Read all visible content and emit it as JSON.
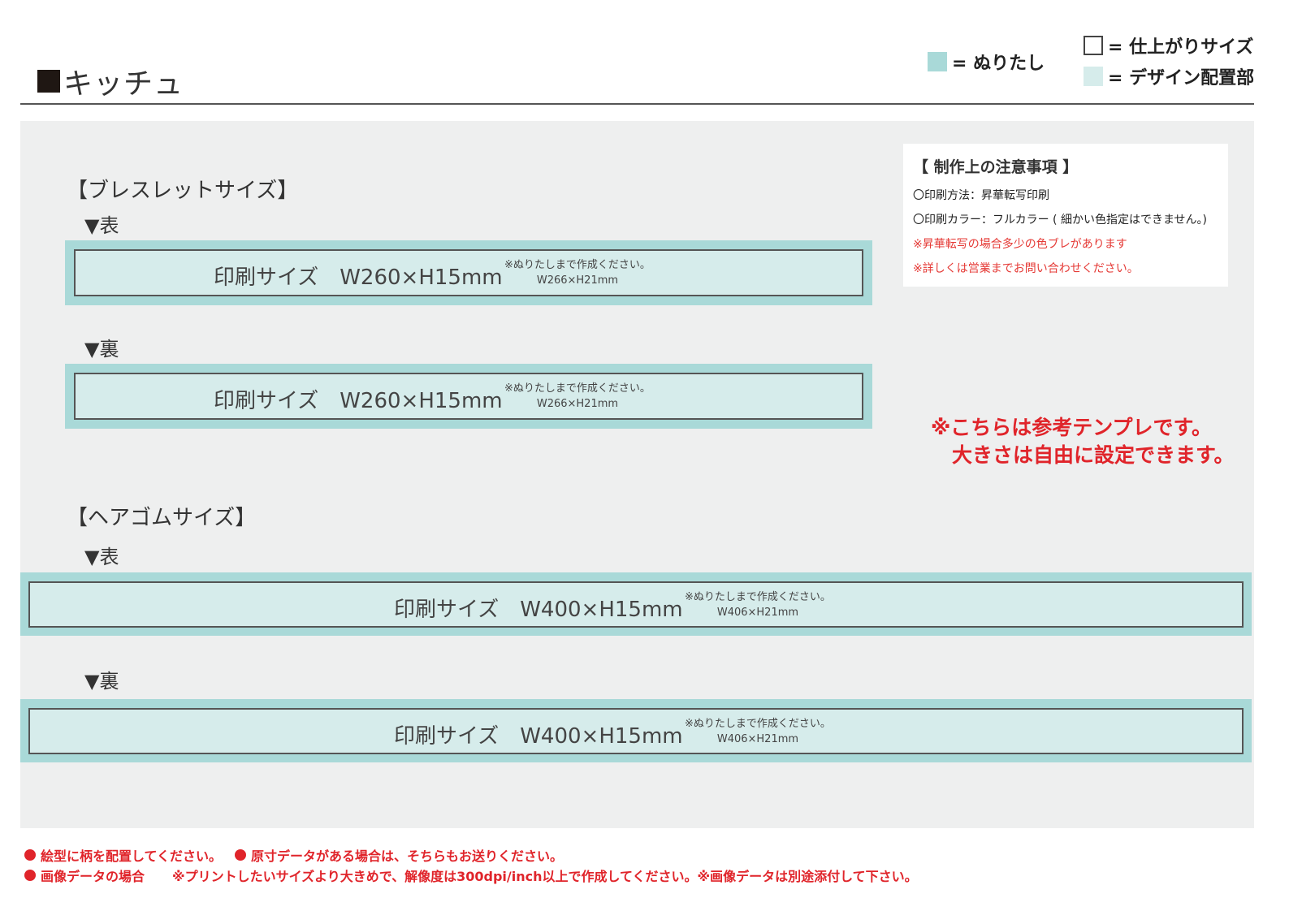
{
  "header": {
    "title": "キッチュ",
    "legend": {
      "bleed": "= ぬりたし",
      "finish": "= 仕上がりサイズ",
      "design": "= デザイン配置部"
    }
  },
  "bracelet": {
    "title": "【ブレスレットサイズ】",
    "front": {
      "label": "▼表",
      "size": "印刷サイズ　W260×H15mm",
      "note1": "※ぬりたしまで作成ください。",
      "note2": "W266×H21mm"
    },
    "back": {
      "label": "▼裏",
      "size": "印刷サイズ　W260×H15mm",
      "note1": "※ぬりたしまで作成ください。",
      "note2": "W266×H21mm"
    }
  },
  "hairtie": {
    "title": "【ヘアゴムサイズ】",
    "front": {
      "label": "▼表",
      "size": "印刷サイズ　W400×H15mm",
      "note1": "※ぬりたしまで作成ください。",
      "note2": "W406×H21mm"
    },
    "back": {
      "label": "▼裏",
      "size": "印刷サイズ　W400×H15mm",
      "note1": "※ぬりたしまで作成ください。",
      "note2": "W406×H21mm"
    }
  },
  "notes": {
    "heading": "【 制作上の注意事項 】",
    "lines": [
      "〇印刷方法：昇華転写印刷",
      "〇印刷カラー：フルカラー ( 細かい色指定はできません。)",
      "※昇華転写の場合多少の色ブレがあります",
      "※詳しくは営業までお問い合わせください。"
    ]
  },
  "reference_note": {
    "line1": "※こちらは参考テンプレです。",
    "line2": "大きさは自由に設定できます。"
  },
  "footer": {
    "item1": "絵型に柄を配置してください。",
    "item2": "原寸データがある場合は、そちらもお送りください。",
    "item3": "画像データの場合",
    "item3_detail": "※プリントしたいサイズより大きめで、解像度は300dpi/inch以上で作成してください。※画像データは別途添付して下さい。"
  },
  "colors": {
    "bleed": "#a9d9d8",
    "design": "#d6eceb",
    "panel": "#eeefef",
    "alert": "#e0242a"
  }
}
